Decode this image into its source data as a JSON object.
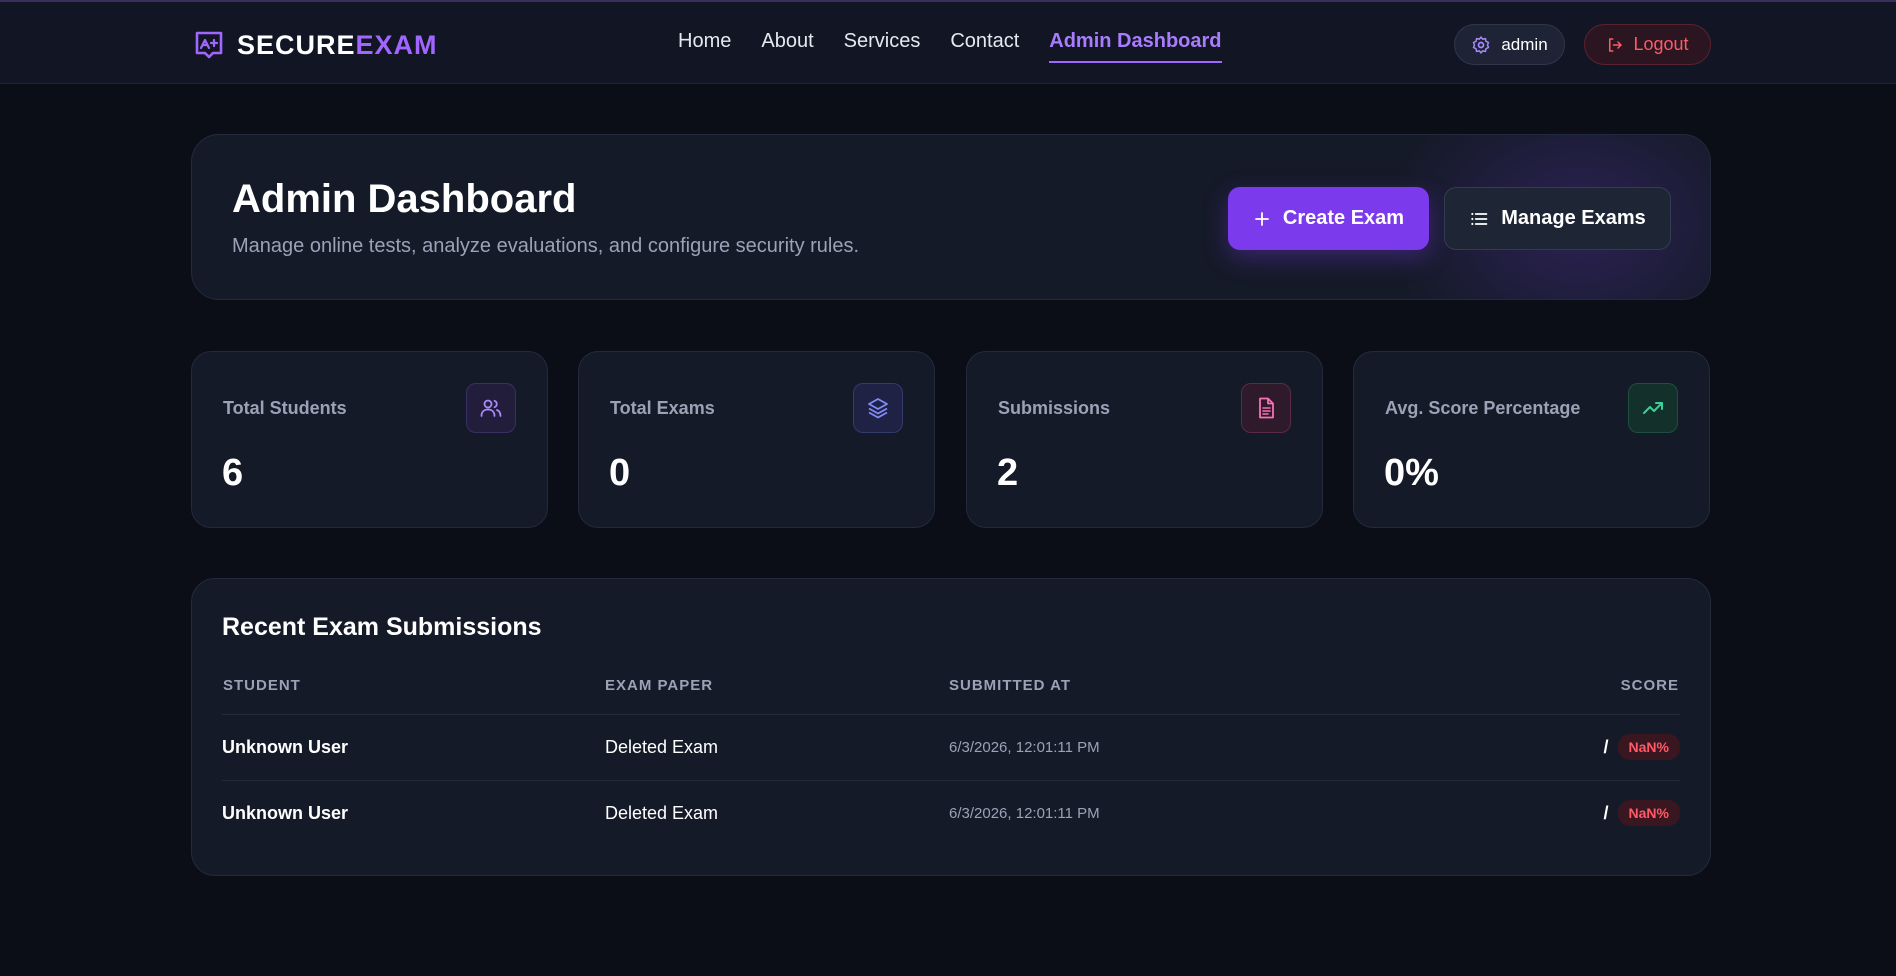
{
  "brand": {
    "word1": "SECURE",
    "word2": "EXAM",
    "accent": "#a066ff"
  },
  "nav": {
    "links": [
      "Home",
      "About",
      "Services",
      "Contact"
    ],
    "active": "Admin Dashboard"
  },
  "user": {
    "name": "admin",
    "icon": "gear-icon"
  },
  "logout": {
    "label": "Logout",
    "icon": "logout-icon",
    "color": "#ff5a66"
  },
  "hero": {
    "title": "Admin Dashboard",
    "subtitle": "Manage online tests, analyze evaluations, and configure security rules.",
    "create_label": "Create Exam",
    "manage_label": "Manage Exams"
  },
  "stats": [
    {
      "label": "Total Students",
      "value": "6",
      "icon": "users-icon",
      "color": "#a78bfa"
    },
    {
      "label": "Total Exams",
      "value": "0",
      "icon": "layers-icon",
      "color": "#818cf8"
    },
    {
      "label": "Submissions",
      "value": "2",
      "icon": "document-icon",
      "color": "#f472b6"
    },
    {
      "label": "Avg. Score Percentage",
      "value": "0%",
      "icon": "trending-up-icon",
      "color": "#34d399"
    }
  ],
  "submissions": {
    "title": "Recent Exam Submissions",
    "columns": [
      "STUDENT",
      "EXAM PAPER",
      "SUBMITTED AT",
      "SCORE"
    ],
    "rows": [
      {
        "student": "Unknown User",
        "exam": "Deleted Exam",
        "submitted": "6/3/2026, 12:01:11 PM",
        "score": "/",
        "pct": "NaN%"
      },
      {
        "student": "Unknown User",
        "exam": "Deleted Exam",
        "submitted": "6/3/2026, 12:01:11 PM",
        "score": "/",
        "pct": "NaN%"
      }
    ]
  }
}
